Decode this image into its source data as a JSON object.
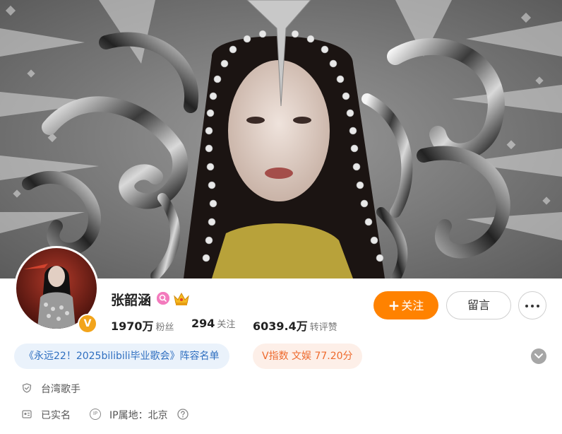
{
  "profile": {
    "name": "张韶涵",
    "verified_badge": "V",
    "badges": [
      "pink-circle-badge-icon",
      "crown-badge-icon"
    ],
    "stats": {
      "followers": {
        "value": "1970万",
        "label": "粉丝"
      },
      "following": {
        "value": "294",
        "label": "关注"
      },
      "interactions": {
        "value": "6039.4万",
        "label": "转评赞"
      }
    }
  },
  "actions": {
    "follow_label": "关注",
    "follow_icon": "+",
    "message_label": "留言",
    "more_icon": "more-dots-icon"
  },
  "tags": {
    "event": "《永远22！2025bilibili毕业歌会》阵容名单",
    "v_index": "V指数 文娱 77.20分"
  },
  "info": {
    "title": "台湾歌手",
    "real_name": "已实名",
    "ip_prefix": "IP",
    "ip_location": "IP属地：北京"
  },
  "colors": {
    "accent": "#ff8200",
    "tag_blue_text": "#2f6fc0",
    "tag_blue_bg": "#eaf2fb",
    "tag_orange_text": "#ee6a2d",
    "tag_orange_bg": "#fdefe8",
    "verified": "#f2a41b"
  }
}
